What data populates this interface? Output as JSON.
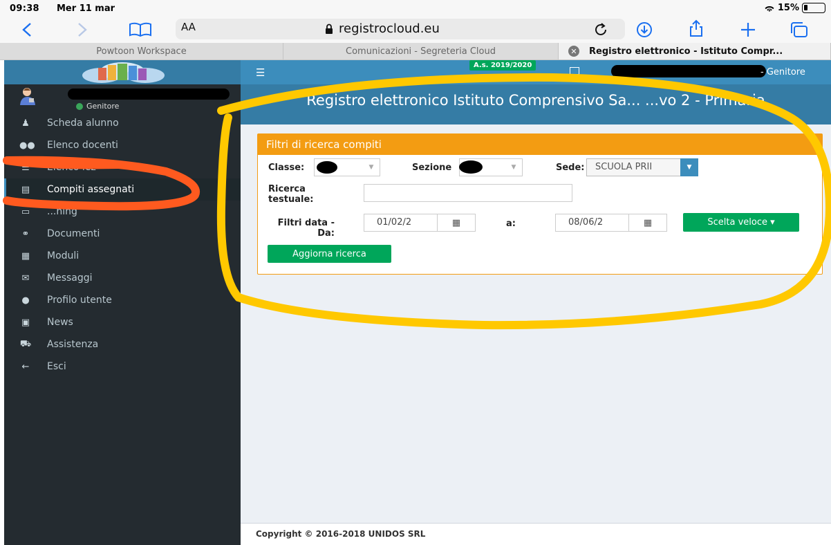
{
  "statusbar": {
    "time": "09:38",
    "date": "Mer 11 mar",
    "battery": "15%"
  },
  "browser": {
    "text_size_label": "AA",
    "url": "registrocloud.eu",
    "tabs": [
      {
        "label": "Powtoon Workspace"
      },
      {
        "label": "Comunicazioni - Segreteria Cloud"
      },
      {
        "label": "Registro elettronico - Istituto Compr..."
      }
    ],
    "icons": [
      "back-icon",
      "forward-icon",
      "bookmarks-icon",
      "reload-icon",
      "download-icon",
      "share-icon",
      "new-tab-icon",
      "tabs-overview-icon"
    ]
  },
  "sidebar": {
    "user_status": "Genitore",
    "items": [
      {
        "label": "Scheda alunno",
        "icon": "child-icon"
      },
      {
        "label": "Elenco docenti",
        "icon": "users-icon"
      },
      {
        "label": "Elenco lez",
        "icon": "list-icon"
      },
      {
        "label": "Compiti assegnati",
        "icon": "assignment-icon"
      },
      {
        "label": "...ning",
        "icon": "elearning-icon"
      },
      {
        "label": "Documenti",
        "icon": "paperclip-icon"
      },
      {
        "label": "Moduli",
        "icon": "forms-icon"
      },
      {
        "label": "Messaggi",
        "icon": "envelope-icon"
      },
      {
        "label": "Profilo utente",
        "icon": "user-icon"
      },
      {
        "label": "News",
        "icon": "newspaper-icon"
      },
      {
        "label": "Assistenza",
        "icon": "ambulance-icon"
      },
      {
        "label": "Esci",
        "icon": "arrow-left-icon"
      }
    ],
    "active_index": 3
  },
  "topnav": {
    "school_year": "A.s. 2019/2020",
    "role": "- Genitore"
  },
  "header": {
    "title": "Registro elettronico Istituto Comprensivo Sa... ...vo 2 - Primaria"
  },
  "filters": {
    "title": "Filtri di ricerca compiti",
    "classe_label": "Classe:",
    "sezione_label": "Sezione",
    "sede_label": "Sede:",
    "sede_value": "SCUOLA PRII",
    "ricerca_label": "Ricerca testuale:",
    "ricerca_value": "",
    "date_label": "Filtri data - Da:",
    "date_from": "01/02/2",
    "a_label": "a:",
    "date_to": "08/06/2",
    "quick_button": "Scelta veloce ▾",
    "refresh_button": "Aggiorna ricerca"
  },
  "footer": {
    "text": "Copyright © 2016-2018 UNIDOS SRL"
  },
  "colors": {
    "accent": "#3c8dbc",
    "header": "#357ca5",
    "warning": "#f39c12",
    "success": "#00a65a",
    "sidebar": "#242b30"
  }
}
